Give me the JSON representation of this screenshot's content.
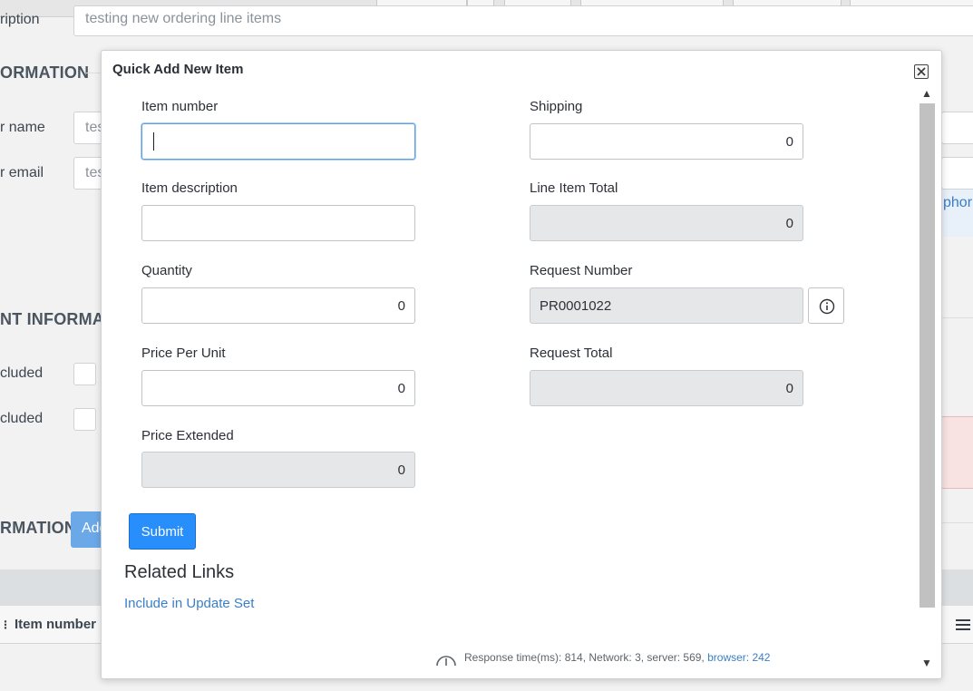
{
  "background": {
    "top_text": "testing new ordering line items",
    "labels": {
      "description": "ription",
      "section_information": "ORMATION",
      "requester_name": "r name",
      "requester_email": "r email",
      "section_payment": "NT INFORMATI",
      "included_1": "cluded",
      "included_2": "cluded",
      "section_items": "RMATION"
    },
    "values": {
      "name_value": "tes",
      "email_value": "tes"
    },
    "add_button": "Add",
    "phone_link": "phor",
    "table_header": "Item number",
    "colors": {
      "page_bg": "#f2f2f2",
      "right_highlight": "#e8f0fa",
      "right_error": "#f8e2e2"
    }
  },
  "modal": {
    "title": "Quick Add New Item",
    "close_icon": "close-x-icon",
    "fields": {
      "item_number": {
        "label": "Item number",
        "value": ""
      },
      "item_description": {
        "label": "Item description",
        "value": ""
      },
      "quantity": {
        "label": "Quantity",
        "value": "0"
      },
      "price_per_unit": {
        "label": "Price Per Unit",
        "value": "0"
      },
      "price_extended": {
        "label": "Price Extended",
        "value": "0"
      },
      "shipping": {
        "label": "Shipping",
        "value": "0"
      },
      "line_item_total": {
        "label": "Line Item Total",
        "value": "0"
      },
      "request_number": {
        "label": "Request Number",
        "value": "PR0001022"
      },
      "request_total": {
        "label": "Request Total",
        "value": "0"
      }
    },
    "info_icon": "info-circle-icon",
    "submit_label": "Submit",
    "related_links": {
      "title": "Related Links",
      "items": [
        "Include in Update Set"
      ]
    },
    "footer": {
      "text": "Response time(ms): 814, Network: 3, server: 569, ",
      "browser": "browser: 242"
    },
    "colors": {
      "accent": "#278efc",
      "link": "#3a7ec7",
      "readonly_bg": "#e6e7e8",
      "focus_border": "#5ea0e8"
    }
  }
}
